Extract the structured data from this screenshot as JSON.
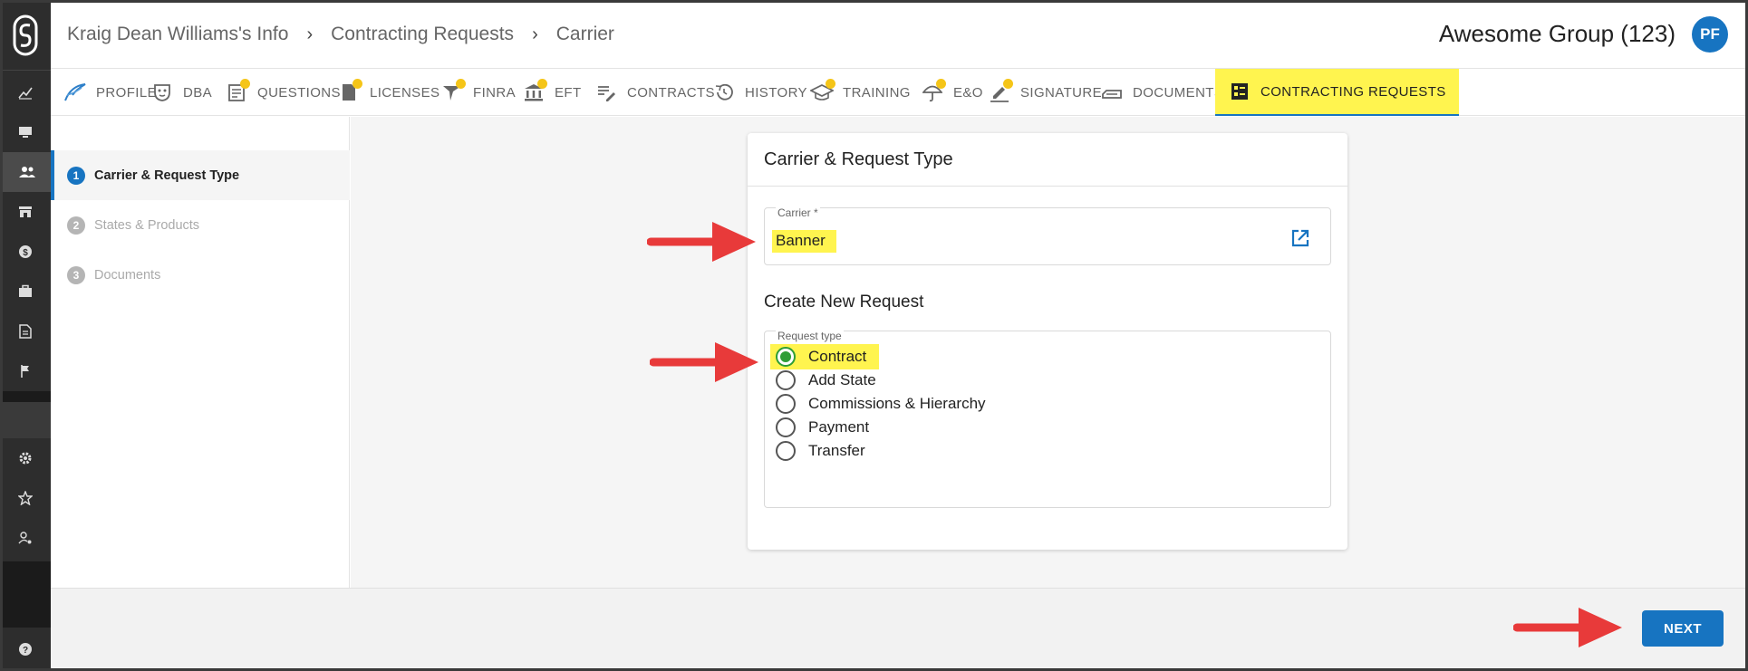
{
  "rail": {
    "items": [
      {
        "icon": "analytics-icon"
      },
      {
        "icon": "monitor-icon"
      },
      {
        "icon": "people-icon",
        "active": true
      },
      {
        "icon": "store-icon"
      },
      {
        "icon": "dollar-icon"
      },
      {
        "icon": "briefcase-icon"
      },
      {
        "icon": "document-icon"
      },
      {
        "icon": "flag-icon"
      },
      {
        "icon": "settings-icon"
      },
      {
        "icon": "star-icon"
      },
      {
        "icon": "user-settings-icon"
      }
    ]
  },
  "header": {
    "breadcrumbs": [
      "Kraig Dean Williams's Info",
      "Contracting Requests",
      "Carrier"
    ],
    "org_name": "Awesome Group (123)",
    "avatar_initials": "PF"
  },
  "tabs": [
    {
      "label": "PROFILE",
      "icon": "profile-icon",
      "dot": false
    },
    {
      "label": "DBA",
      "icon": "mask-icon",
      "dot": false
    },
    {
      "label": "QUESTIONS",
      "icon": "questions-icon",
      "dot": true
    },
    {
      "label": "LICENSES",
      "icon": "license-icon",
      "dot": true
    },
    {
      "label": "FINRA",
      "icon": "finra-icon",
      "dot": true
    },
    {
      "label": "EFT",
      "icon": "bank-icon",
      "dot": true
    },
    {
      "label": "CONTRACTS",
      "icon": "contract-pen-icon",
      "dot": false
    },
    {
      "label": "HISTORY",
      "icon": "history-icon",
      "dot": false
    },
    {
      "label": "TRAINING",
      "icon": "graduation-cap-icon",
      "dot": true
    },
    {
      "label": "E&O",
      "icon": "umbrella-icon",
      "dot": true
    },
    {
      "label": "SIGNATURE",
      "icon": "signature-icon",
      "dot": true
    },
    {
      "label": "DOCUMENTS",
      "icon": "documents-icon",
      "dot": false
    },
    {
      "label": "CONTRACTING REQUESTS",
      "icon": "requests-icon",
      "dot": false,
      "active": true
    }
  ],
  "steps": [
    {
      "num": "1",
      "label": "Carrier & Request Type",
      "active": true
    },
    {
      "num": "2",
      "label": "States & Products",
      "active": false
    },
    {
      "num": "3",
      "label": "Documents",
      "active": false
    }
  ],
  "card": {
    "title": "Carrier & Request Type",
    "carrier_label": "Carrier *",
    "carrier_value": "Banner",
    "section_title": "Create New Request",
    "request_type_label": "Request type",
    "options": [
      "Contract",
      "Add State",
      "Commissions & Hierarchy",
      "Payment",
      "Transfer"
    ],
    "selected_option": "Contract"
  },
  "footer": {
    "next_label": "NEXT"
  },
  "colors": {
    "accent": "#1774c1",
    "highlight": "#fff44f",
    "arrow": "#e83a3a",
    "radio_selected": "#2e9d36",
    "rail": "#2d2d2d"
  }
}
